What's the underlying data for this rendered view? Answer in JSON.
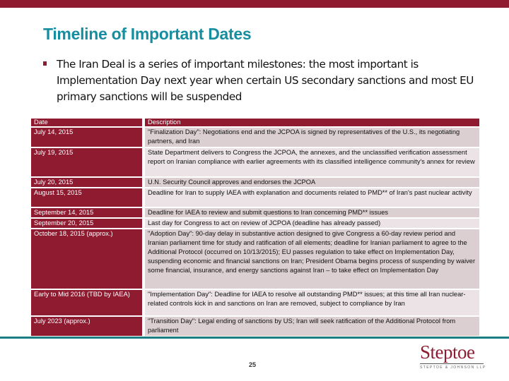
{
  "slide": {
    "title": "Timeline of Important Dates",
    "bullet": "The Iran Deal is a series of important milestones: the most important is Implementation Day next year when certain US secondary sanctions and most EU primary sanctions will be suspended",
    "page_number": "25",
    "colors": {
      "brand": "#8f1b31",
      "title": "#178ea0",
      "rule": "#1a7f85",
      "row_odd": "#dccfd2",
      "row_even": "#ebe3e5"
    }
  },
  "table": {
    "headers": {
      "date": "Date",
      "description": "Description"
    },
    "rows": [
      {
        "date": "July 14, 2015",
        "description": "\"Finalization Day\": Negotiations end and the JCPOA is signed by representatives of the U.S., its negotiating partners, and Iran"
      },
      {
        "date": "July 19, 2015",
        "description": "State Department delivers to Congress the JCPOA, the annexes, and the unclassified verification assessment report on Iranian compliance with earlier agreements with its classified intelligence community's annex for review"
      },
      {
        "date": "July 20, 2015",
        "description": "U.N. Security Council approves and endorses the JCPOA"
      },
      {
        "date": "August 15, 2015",
        "description": "Deadline for Iran to supply IAEA with explanation and documents related to PMD** of Iran's past nuclear activity"
      },
      {
        "date": "September 14, 2015",
        "description": "Deadline for IAEA to review and submit questions to Iran concerning PMD** issues"
      },
      {
        "date": "September 20, 2015",
        "description": "Last day for Congress to act on review of JCPOA (deadline has already passed)"
      },
      {
        "date": "October 18, 2015 (approx.)",
        "description": "\"Adoption Day\": 90-day delay in substantive action designed to give Congress a 60-day review period and Iranian parliament time for study and ratification of all elements; deadline for Iranian parliament to agree to the Additional Protocol (occurred on 10/13/2015); EU passes regulation to take effect on Implementation Day, suspending economic and financial sanctions on Iran; President Obama begins process of suspending by waiver some financial, insurance, and energy sanctions against Iran – to take effect on Implementation Day"
      },
      {
        "date": "Early to Mid 2016 (TBD by IAEA)",
        "description": "\"Implementation Day\": Deadline for IAEA to resolve all outstanding PMD** issues; at this time all Iran nuclear-related controls kick in and sanctions on Iran are removed, subject to compliance by Iran"
      },
      {
        "date": "July 2023 (approx.)",
        "description": "\"Transition Day\": Legal ending of sanctions by US; Iran will seek ratification of the Additional Protocol from parliament"
      }
    ]
  },
  "logo": {
    "name": "Steptoe",
    "subtitle": "STEPTOE & JOHNSON LLP"
  }
}
